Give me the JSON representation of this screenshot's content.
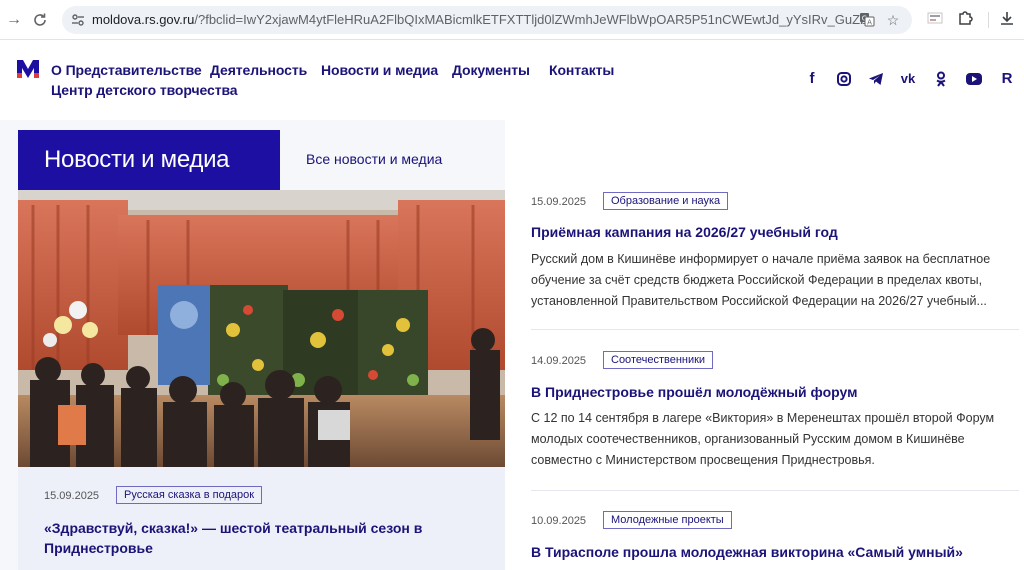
{
  "browser": {
    "url_host": "moldova.rs.gov.ru",
    "url_rest": "/?fbclid=IwY2xjawM4ytFleHRuA2FlbQIxMABicmlkETFXTTljd0lZWmhJeWFlbWpOAR5P51nCWEwtJd_yYsIRv_GuZbe5S3ST-1pBd37p...",
    "icons": [
      "forward-icon",
      "reload-icon",
      "site-info-icon",
      "translate-icon",
      "bookmark-star-icon",
      "extension-icon",
      "extensions-puzzle-icon",
      "download-icon"
    ]
  },
  "header": {
    "menu": [
      "О Представительстве",
      "Деятельность",
      "Новости и медиа",
      "Документы",
      "Контакты",
      "Центр детского творчества"
    ],
    "social_icons": [
      "facebook-icon",
      "instagram-icon",
      "telegram-icon",
      "vk-icon",
      "odnoklassniki-icon",
      "youtube-icon",
      "rutube-icon"
    ],
    "rutube_letter": "R",
    "brand_color": "#1d0fa1"
  },
  "section": {
    "title": "Новости и медиа",
    "all_news_link": "Все новости и медиа"
  },
  "feature": {
    "date": "15.09.2025",
    "tag": "Русская сказка в подарок",
    "title": "«Здравствуй, сказка!» — шестой театральный сезон в Приднестровье"
  },
  "news": [
    {
      "date": "15.09.2025",
      "tag": "Образование и наука",
      "title": "Приёмная кампания на 2026/27 учебный год",
      "text": "Русский дом в Кишинёве информирует о начале приёма заявок на бесплатное обучение за счёт средств бюджета Российской Федерации в пределах квоты, установленной Правительством Российской Федерации на 2026/27 учебный..."
    },
    {
      "date": "14.09.2025",
      "tag": "Соотечественники",
      "title": "В Приднестровье прошёл молодёжный форум",
      "text": "С 12 по 14 сентября в лагере «Виктория» в Меренештах прошёл второй Форум молодых соотечественников, организованный Русским домом в Кишинёве совместно с Министерством просвещения Приднестровья."
    },
    {
      "date": "10.09.2025",
      "tag": "Молодежные проекты",
      "title": "В Тирасполе прошла молодежная викторина «Самый умный»",
      "text": ""
    }
  ]
}
